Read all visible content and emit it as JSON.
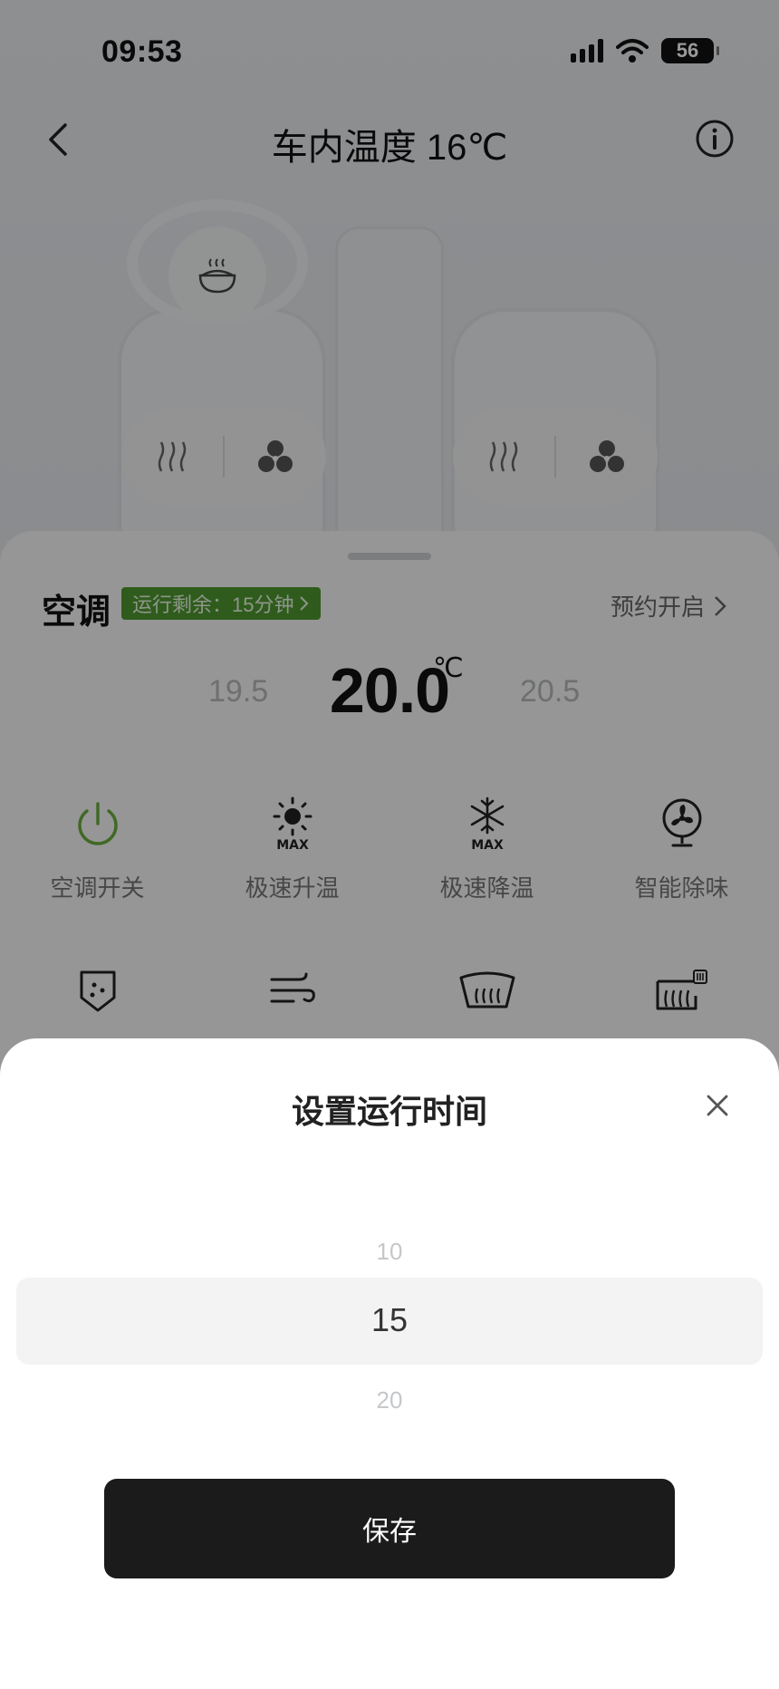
{
  "status_bar": {
    "time": "09:53",
    "battery": "56"
  },
  "header": {
    "title": "车内温度 16℃"
  },
  "panel": {
    "ac_label": "空调",
    "runtime_badge": "运行剩余：15分钟",
    "schedule_label": "预约开启",
    "temp_prev": "19.5",
    "temp_current": "20.0",
    "temp_unit": "℃",
    "temp_next": "20.5",
    "functions": [
      {
        "label": "空调开关",
        "icon": "power-icon"
      },
      {
        "label": "极速升温",
        "icon": "sun-max-icon"
      },
      {
        "label": "极速降温",
        "icon": "snowflake-max-icon"
      },
      {
        "label": "智能除味",
        "icon": "fan-icon"
      }
    ],
    "functions_row2": [
      {
        "icon": "filter-icon"
      },
      {
        "icon": "wind-icon"
      },
      {
        "icon": "front-defrost-icon"
      },
      {
        "icon": "rear-defrost-icon"
      }
    ]
  },
  "sheet": {
    "title": "设置运行时间",
    "picker": {
      "prev": "10",
      "selected": "15",
      "next": "20"
    },
    "save_label": "保存"
  },
  "colors": {
    "accent_green": "#4f9a2f",
    "save_button": "#1b1b1b"
  }
}
